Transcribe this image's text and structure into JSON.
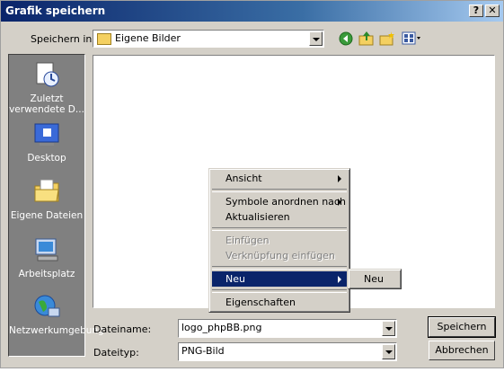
{
  "window": {
    "title": "Grafik speichern",
    "help_label": "?",
    "close_label": "✕"
  },
  "location": {
    "label": "Speichern in:",
    "value": "Eigene Bilder"
  },
  "places": [
    {
      "label": "Zuletzt verwendete D...",
      "icon": "recent-documents-icon"
    },
    {
      "label": "Desktop",
      "icon": "desktop-icon"
    },
    {
      "label": "Eigene Dateien",
      "icon": "my-documents-icon"
    },
    {
      "label": "Arbeitsplatz",
      "icon": "my-computer-icon"
    },
    {
      "label": "Netzwerkumgebung",
      "icon": "network-places-icon"
    }
  ],
  "filename": {
    "label": "Dateiname:",
    "value": "logo_phpBB.png"
  },
  "filetype": {
    "label": "Dateityp:",
    "value": "PNG-Bild"
  },
  "buttons": {
    "save": "Speichern",
    "cancel": "Abbrechen"
  },
  "context_menu": {
    "items": [
      {
        "label": "Ansicht"
      },
      {
        "label": "Symbole anordnen nach"
      },
      {
        "label": "Aktualisieren"
      },
      {
        "label": "Einfügen"
      },
      {
        "label": "Verknüpfung einfügen"
      },
      {
        "label": "Neu"
      },
      {
        "label": "Eigenschaften"
      }
    ]
  },
  "submenu": {
    "items": [
      {
        "label": "Neu"
      }
    ]
  },
  "colors": {
    "title_active": "#0a246a",
    "face": "#d4d0c8",
    "highlight": "#0a246a"
  }
}
